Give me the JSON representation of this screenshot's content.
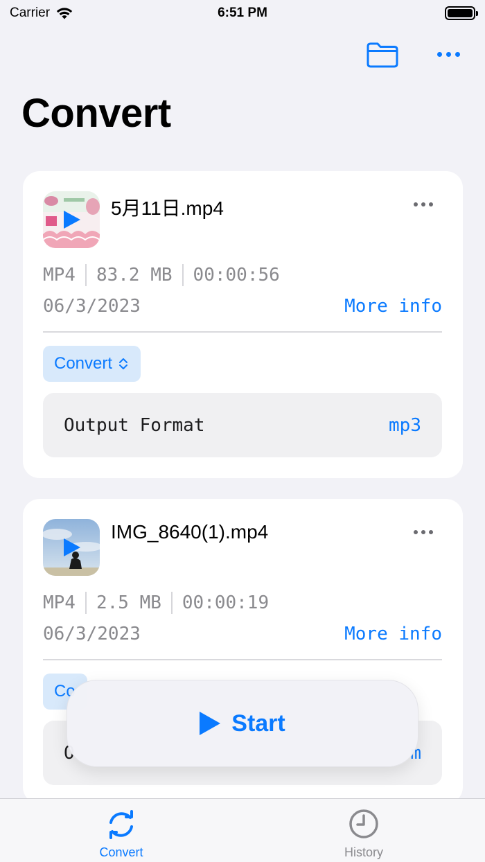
{
  "status_bar": {
    "carrier": "Carrier",
    "time": "6:51 PM"
  },
  "nav": {
    "folder_icon": "folder-icon",
    "more_icon": "ellipsis-icon"
  },
  "page": {
    "title": "Convert"
  },
  "files": [
    {
      "name": "5月11日.mp4",
      "format": "MP4",
      "size": "83.2 MB",
      "duration": "00:00:56",
      "date": "06/3/2023",
      "more_info": "More info",
      "action": "Convert",
      "output_label": "Output Format",
      "output_value": "mp3"
    },
    {
      "name": "IMG_8640(1).mp4",
      "format": "MP4",
      "size": "2.5 MB",
      "duration": "00:00:19",
      "date": "06/3/2023",
      "more_info": "More info",
      "action": "Co",
      "output_label": "O",
      "output_value": "m"
    }
  ],
  "start_button": {
    "label": "Start"
  },
  "tabs": [
    {
      "label": "Convert",
      "icon": "refresh-icon",
      "active": true
    },
    {
      "label": "History",
      "icon": "clock-icon",
      "active": false
    }
  ],
  "colors": {
    "accent": "#0a7aff",
    "background": "#f2f2f7",
    "inactive": "#8a8a8e"
  }
}
